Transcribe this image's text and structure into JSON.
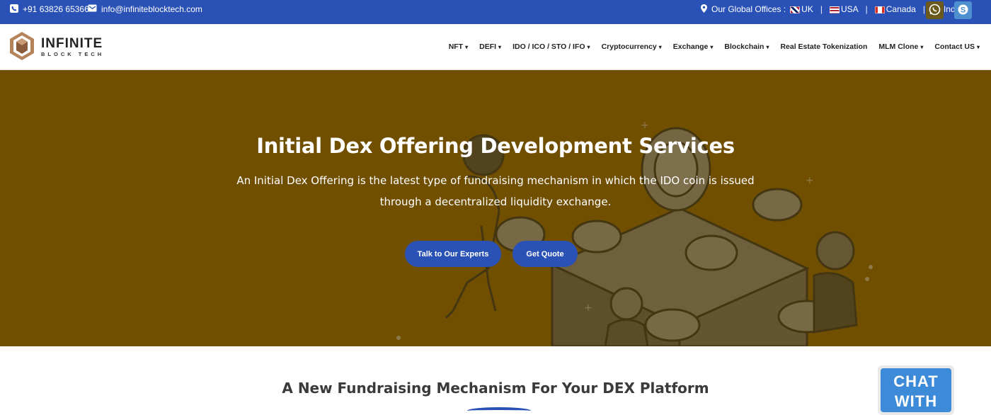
{
  "topbar": {
    "phone": "+91 63826 65366",
    "email": "info@infiniteblocktech.com",
    "offices_label": "Our Global Offices :",
    "offices": [
      "UK",
      "USA",
      "Canada",
      "India"
    ],
    "separator": "|"
  },
  "brand": {
    "name": "INFINITE",
    "tagline": "BLOCK TECH"
  },
  "nav": {
    "items": [
      {
        "label": "NFT",
        "dropdown": true
      },
      {
        "label": "DEFI",
        "dropdown": true
      },
      {
        "label": "IDO / ICO / STO / IFO",
        "dropdown": true
      },
      {
        "label": "Cryptocurrency",
        "dropdown": true
      },
      {
        "label": "Exchange",
        "dropdown": true
      },
      {
        "label": "Blockchain",
        "dropdown": true
      },
      {
        "label": "Real Estate Tokenization",
        "dropdown": false
      },
      {
        "label": "MLM Clone",
        "dropdown": true
      },
      {
        "label": "Contact US",
        "dropdown": true
      }
    ]
  },
  "hero": {
    "title": "Initial Dex Offering Development Services",
    "description": "An Initial Dex Offering is the latest type of fundraising mechanism in which the IDO coin is issued through a decentralized liquidity exchange.",
    "cta_primary": "Talk to Our Experts",
    "cta_secondary": "Get Quote"
  },
  "section": {
    "title": "A New Fundraising Mechanism For Your DEX Platform"
  },
  "chat": {
    "label": "CHAT WITH"
  },
  "colors": {
    "brand_blue": "#2a52b6",
    "hero_bg": "#704f00",
    "whatsapp": "#25d366",
    "skype": "#00aff0"
  },
  "icons": {
    "phone": "phone-icon",
    "email": "email-icon",
    "location": "location-pin-icon",
    "whatsapp": "whatsapp-icon",
    "skype": "skype-icon",
    "caret": "caret-down-icon"
  }
}
